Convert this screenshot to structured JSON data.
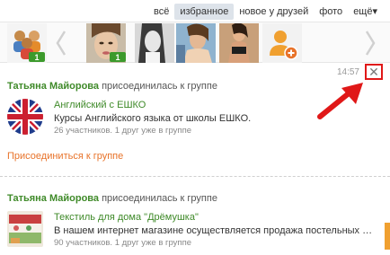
{
  "tabs": [
    {
      "label": "всё",
      "active": false
    },
    {
      "label": "избранное",
      "active": true
    },
    {
      "label": "новое у друзей",
      "active": false
    },
    {
      "label": "фото",
      "active": false
    },
    {
      "label": "ещё▾",
      "active": false
    }
  ],
  "carousel": {
    "badges": [
      "1",
      "1"
    ],
    "items": [
      "friends-group-icon",
      "woman-portrait-photo",
      "woman-bw-photo",
      "woman-selfie-photo",
      "woman-dancing-photo",
      "add-friend-icon"
    ]
  },
  "post1": {
    "time": "14:57",
    "close_label": "✕",
    "author": "Татьяна Майорова",
    "action": " присоединилась к группе",
    "group_title": "Английский с ЕШКО",
    "group_desc": "Курсы Английского языка от школы ЕШКО.",
    "group_meta": "26 участников. 1 друг уже в группе",
    "join_label": "Присоединиться к группе"
  },
  "post2": {
    "author": "Татьяна Майорова",
    "action": " присоединилась к группе",
    "group_title": "Текстиль для дома \"Дрёмушка\"",
    "group_desc": "В нашем интернет магазине осуществляется продажа постельных принад...",
    "group_meta": "90 участников. 1 друг уже в группе"
  },
  "colors": {
    "accent_green": "#3f8a29",
    "link_orange": "#e8732a",
    "badge_green": "#3c9a2c",
    "highlight_red": "#e01818"
  }
}
